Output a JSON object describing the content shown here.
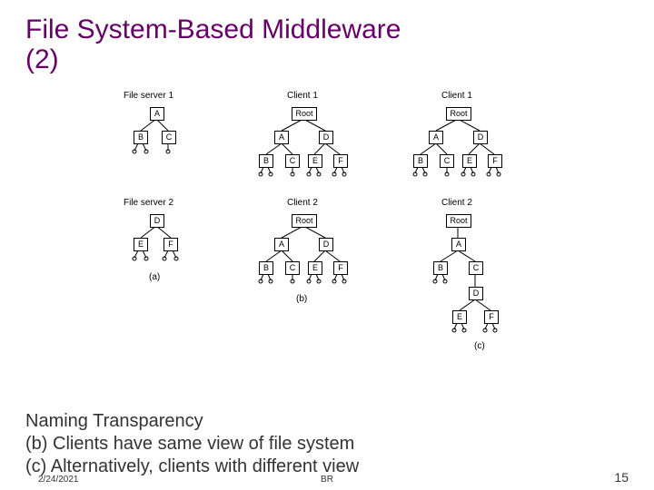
{
  "title_line1": "File System-Based Middleware",
  "title_line2": "(2)",
  "labels": {
    "fs1": "File server 1",
    "fs2": "File server 2",
    "c1a": "Client 1",
    "c1b": "Client 1",
    "c2a": "Client 2",
    "c2b": "Client 2",
    "root": "Root",
    "sub_a": "(a)",
    "sub_b": "(b)",
    "sub_c": "(c)"
  },
  "nodes": {
    "A": "A",
    "B": "B",
    "C": "C",
    "D": "D",
    "E": "E",
    "F": "F"
  },
  "caption": {
    "l1": "Naming Transparency",
    "l2": "(b) Clients have same view of file system",
    "l3": "(c) Alternatively, clients with different view"
  },
  "footer": {
    "date": "2/24/2021",
    "center": "BR",
    "page": "15"
  }
}
